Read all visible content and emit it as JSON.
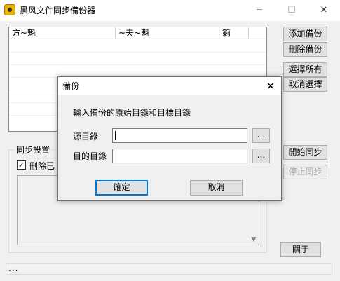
{
  "window": {
    "title": "黑风文件同步備份器",
    "minimize_glyph": "─",
    "maximize_glyph": "☐",
    "close_glyph": "✕"
  },
  "file_list": {
    "columns": [
      "方~魁",
      "~夫~魁",
      "箣"
    ]
  },
  "side_buttons": {
    "add_backup": "添加備份",
    "delete_backup": "刪除備份",
    "select_all": "選擇所有",
    "cancel_select": "取消選擇",
    "start_sync": "開始同步",
    "stop_sync": "停止同步",
    "about": "關于"
  },
  "sync_settings": {
    "legend": "同步設置",
    "delete_option_label": "刪除已",
    "delete_option_checked": true
  },
  "status": {
    "text": "..."
  },
  "dialog": {
    "title": "備份",
    "prompt": "輸入備份的原始目錄和目標目錄",
    "source_label": "源目錄",
    "target_label": "目的目錄",
    "source_value": "",
    "target_value": "",
    "browse_label": "...",
    "ok_label": "確定",
    "cancel_label": "取消",
    "close_glyph": "✕"
  },
  "colors": {
    "focus_border": "#0078d7",
    "icon_accent": "#e8b400"
  },
  "icons": [
    "app-icon",
    "close-icon",
    "checkbox-check-icon",
    "scroll-down-arrow-icon"
  ]
}
